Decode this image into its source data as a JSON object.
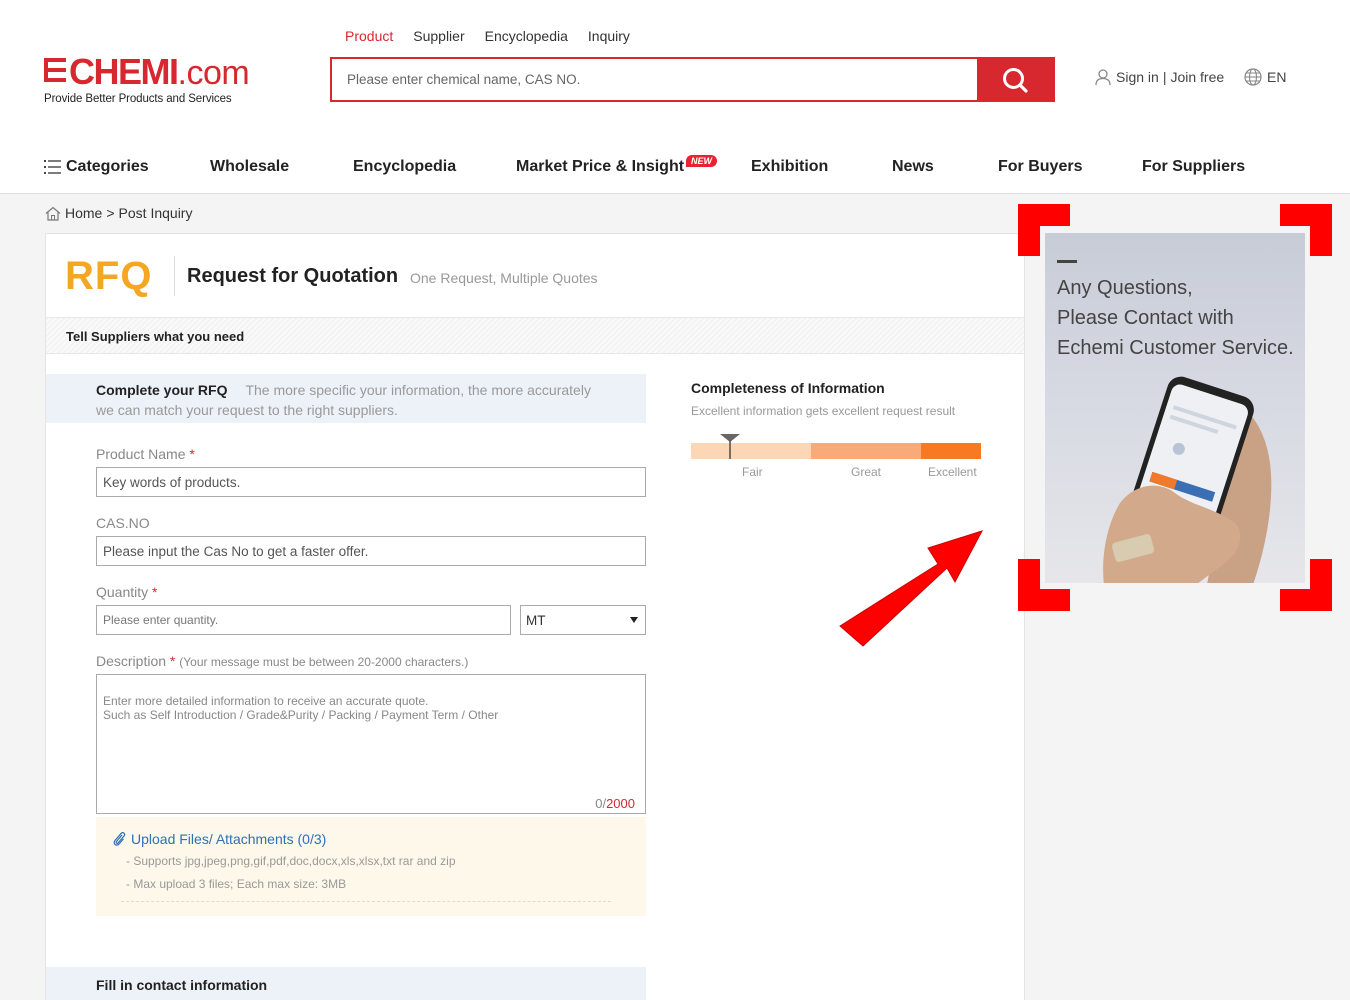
{
  "brand": {
    "logo_red": "CHEMI",
    "logo_com": ".com",
    "tagline": "Provide Better Products and Services"
  },
  "search": {
    "tabs": [
      "Product",
      "Supplier",
      "Encyclopedia",
      "Inquiry"
    ],
    "active_tab": "Product",
    "placeholder": "Please enter chemical name, CAS NO."
  },
  "user": {
    "sign_in": "Sign in",
    "separator": "|",
    "join": "Join free",
    "language": "EN"
  },
  "nav": {
    "categories": "Categories",
    "items": [
      "Wholesale",
      "Encyclopedia",
      "Market Price & Insight",
      "Exhibition",
      "News",
      "For Buyers",
      "For Suppliers"
    ],
    "new_badge": "NEW"
  },
  "breadcrumb": {
    "home": "Home",
    "sep": ">",
    "current": "Post Inquiry"
  },
  "rfq": {
    "logo": "RFQ",
    "title": "Request for Quotation",
    "subtitle": "One Request, Multiple Quotes",
    "tell_suppliers": "Tell Suppliers what you need",
    "complete_title": "Complete your RFQ",
    "complete_hint": "The more specific your information, the more accurately we can match your request to the right suppliers.",
    "product_name_label": "Product Name",
    "product_name_placeholder": "Key words of products.",
    "cas_label": "CAS.NO",
    "cas_placeholder": "Please input the Cas No to get a faster offer.",
    "quantity_label": "Quantity",
    "quantity_placeholder": "Please enter quantity.",
    "unit_value": "MT",
    "description_label": "Description",
    "description_note": "(Your message must be between 20-2000 characters.)",
    "description_placeholder": "Enter more detailed information to receive an accurate quote.\nSuch as Self Introduction / Grade&Purity / Packing / Payment Term / Other",
    "char_count": "0/",
    "char_max": "2000",
    "required_mark": "*",
    "upload_label": "Upload Files/ Attachments (0/3)",
    "upload_note_1": "- Supports jpg,jpeg,png,gif,pdf,doc,docx,xls,xlsx,txt rar and zip",
    "upload_note_2": "- Max upload 3 files; Each max size: 3MB",
    "contact_title": "Fill in contact information"
  },
  "completeness": {
    "title": "Completeness of Information",
    "subtitle": "Excellent information gets excellent request result",
    "levels": [
      "Fair",
      "Great",
      "Excellent"
    ],
    "current_level": 0.135
  },
  "ad": {
    "text": "Any Questions,\nPlease Contact with\nEchemi Customer Service."
  },
  "colors": {
    "brand_red": "#d7282f",
    "rfq_orange": "#f5a623",
    "link_blue": "#2e6fb7",
    "annotation_red": "#ff0000"
  }
}
